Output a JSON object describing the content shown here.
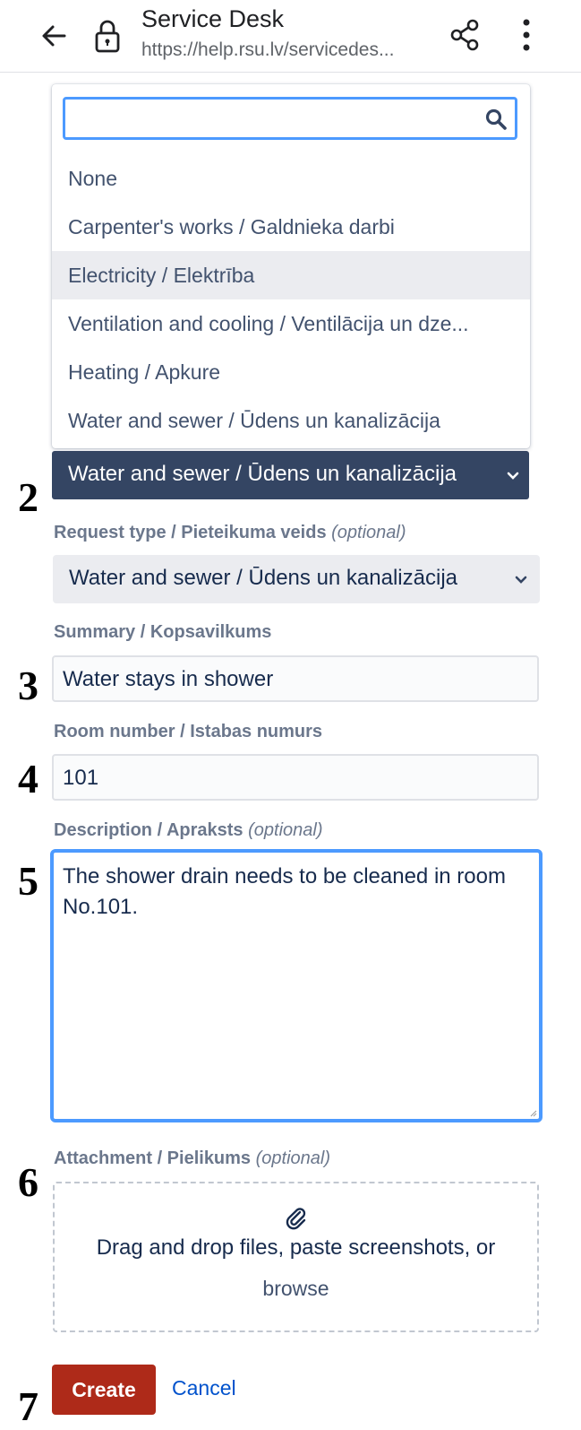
{
  "browser": {
    "title": "Service Desk",
    "url": "https://help.rsu.lv/servicedes..."
  },
  "dropdown": {
    "search_value": "",
    "options": [
      "None",
      "Carpenter's works / Galdnieka darbi",
      "Electricity / Elektrība",
      "Ventilation and cooling / Ventilācija un dze...",
      "Heating / Apkure",
      "Water and sewer / Ūdens un kanalizācija"
    ],
    "highlighted_option": "Electricity / Elektrība"
  },
  "category_select": {
    "value": "Water and sewer / Ūdens un kanalizācija"
  },
  "request_type": {
    "label": "Request type / Pieteikuma veids",
    "optional": "(optional)",
    "value": "Water and sewer / Ūdens un kanalizācija"
  },
  "summary": {
    "label": "Summary / Kopsavilkums",
    "value": "Water stays in shower"
  },
  "room_number": {
    "label": "Room number / Istabas numurs",
    "value": "101"
  },
  "description": {
    "label": "Description / Apraksts",
    "optional": "(optional)",
    "value": "The shower drain needs to be cleaned in room No.101."
  },
  "attachment": {
    "label": "Attachment / Pielikums",
    "optional": "(optional)",
    "drop_text": "Drag and drop files, paste screenshots, or",
    "browse": "browse"
  },
  "actions": {
    "create": "Create",
    "cancel": "Cancel"
  },
  "step_markers": [
    "2",
    "3",
    "4",
    "5",
    "6",
    "7"
  ],
  "colors": {
    "focus_border": "#4c9aff",
    "selected_bg": "#344563",
    "create_button": "#ae2a19",
    "link": "#0052cc"
  }
}
